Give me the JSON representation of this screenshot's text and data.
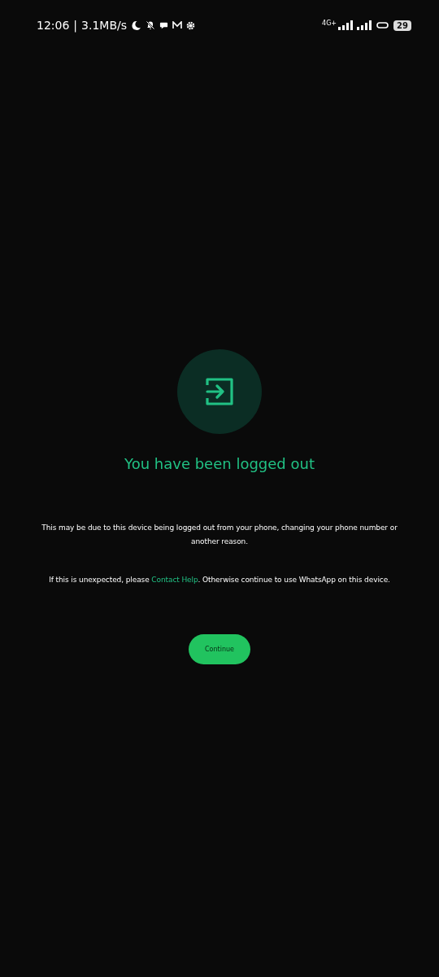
{
  "status_bar": {
    "time": "12:06",
    "separator": "|",
    "speed": "3.1MB/s",
    "network": "4G+",
    "battery": "29"
  },
  "title": "You have been logged out",
  "message": "This may be due to this device being logged out from your phone, changing your phone number or another reason.",
  "help": {
    "before": "If this is unexpected, please ",
    "link": "Contact Help",
    "after": ". Otherwise continue to use WhatsApp on this device."
  },
  "button": "Continue"
}
